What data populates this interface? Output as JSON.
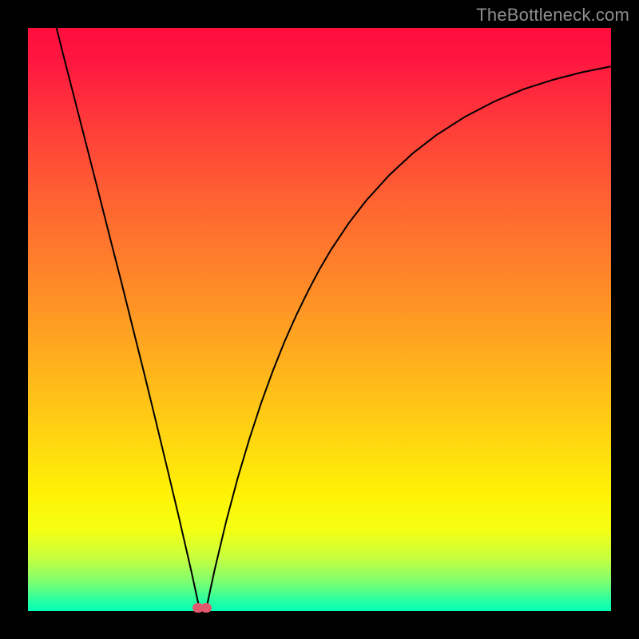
{
  "watermark": "TheBottleneck.com",
  "chart_data": {
    "type": "line",
    "title": "",
    "xlabel": "",
    "ylabel": "",
    "xlim": [
      0,
      100
    ],
    "ylim": [
      0,
      100
    ],
    "grid": false,
    "legend": false,
    "series": [
      {
        "name": "left-branch",
        "x": [
          4.9,
          6,
          8,
          10,
          12,
          14,
          16,
          18,
          20,
          22,
          24,
          26,
          28,
          29.5
        ],
        "y": [
          100,
          95.6,
          87.8,
          80.0,
          72.2,
          64.3,
          56.5,
          48.5,
          40.5,
          32.3,
          24.0,
          15.6,
          6.9,
          0
        ]
      },
      {
        "name": "right-branch",
        "x": [
          30.5,
          32,
          34,
          36,
          38,
          40,
          42,
          44,
          46,
          48,
          50,
          52,
          55,
          58,
          62,
          66,
          70,
          75,
          80,
          85,
          90,
          95,
          100
        ],
        "y": [
          0,
          7.0,
          15.4,
          22.9,
          29.6,
          35.7,
          41.2,
          46.2,
          50.7,
          54.8,
          58.6,
          62.0,
          66.5,
          70.4,
          74.8,
          78.5,
          81.6,
          84.8,
          87.4,
          89.5,
          91.1,
          92.4,
          93.4
        ]
      }
    ],
    "markers": [
      {
        "name": "minimum-marker-1",
        "x": 29.2,
        "y": 0.6,
        "color": "#e0586c"
      },
      {
        "name": "minimum-marker-2",
        "x": 30.6,
        "y": 0.6,
        "color": "#e0586c"
      }
    ],
    "background_gradient": {
      "type": "vertical",
      "stops": [
        {
          "pos": 0,
          "color": "#ff0d3e"
        },
        {
          "pos": 100,
          "color": "#00ffb8"
        }
      ]
    }
  }
}
